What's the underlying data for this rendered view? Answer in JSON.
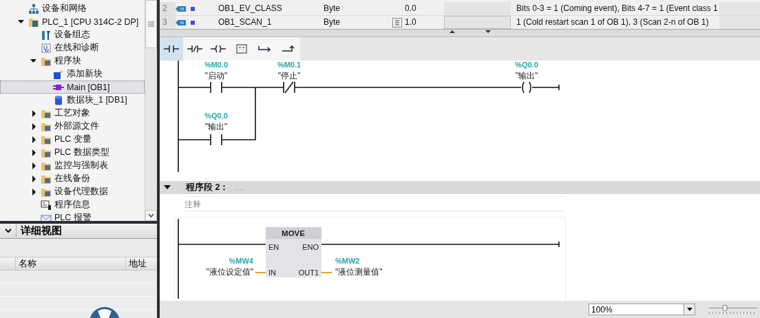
{
  "project_tree": {
    "items": [
      {
        "label": "设备和网络",
        "kind": "network",
        "selected": false
      },
      {
        "label": "PLC_1 [CPU 314C-2 DP]",
        "kind": "plc",
        "selected": false,
        "expanded": true,
        "children": [
          {
            "label": "设备组态",
            "kind": "config",
            "selected": false
          },
          {
            "label": "在线和诊断",
            "kind": "diagnostics",
            "selected": false
          },
          {
            "label": "程序块",
            "kind": "folder",
            "selected": false,
            "expanded": true,
            "children": [
              {
                "label": "添加新块",
                "kind": "add",
                "selected": false
              },
              {
                "label": "Main [OB1]",
                "kind": "ob",
                "selected": true
              },
              {
                "label": "数据块_1 [DB1]",
                "kind": "db",
                "selected": false
              }
            ]
          },
          {
            "label": "工艺对象",
            "kind": "folder",
            "selected": false,
            "expanded": false
          },
          {
            "label": "外部源文件",
            "kind": "folder",
            "selected": false,
            "expanded": false
          },
          {
            "label": "PLC 变量",
            "kind": "folder",
            "selected": false,
            "expanded": false
          },
          {
            "label": "PLC 数据类型",
            "kind": "folder",
            "selected": false,
            "expanded": false
          },
          {
            "label": "监控与强制表",
            "kind": "folder",
            "selected": false,
            "expanded": false
          },
          {
            "label": "在线备份",
            "kind": "folder",
            "selected": false,
            "expanded": false
          },
          {
            "label": "设备代理数据",
            "kind": "folder",
            "selected": false,
            "expanded": false
          },
          {
            "label": "程序信息",
            "kind": "info",
            "selected": false
          },
          {
            "label": "PLC 报警",
            "kind": "alarm",
            "selected": false
          }
        ]
      }
    ]
  },
  "details_view": {
    "title": "详细视图",
    "expanded": true,
    "columns": [
      "名称",
      "地址"
    ]
  },
  "interface_table": {
    "rows": [
      {
        "index": "2",
        "name": "OB1_EV_CLASS",
        "type": "Byte",
        "value": "0.0",
        "comment": "Bits 0-3 = 1 (Coming event), Bits 4-7 = 1 (Event class 1",
        "editing": false
      },
      {
        "index": "3",
        "name": "OB1_SCAN_1",
        "type": "Byte",
        "value": "1.0",
        "comment": "1 (Cold restart scan 1 of OB 1), 3 (Scan 2-n of OB 1)",
        "editing": true
      }
    ]
  },
  "toolbar": [
    {
      "kind": "no-contact",
      "selected": true
    },
    {
      "kind": "nc-contact",
      "selected": false
    },
    {
      "kind": "coil",
      "selected": false
    },
    {
      "kind": "empty-box",
      "selected": false
    },
    {
      "kind": "open-branch",
      "selected": false
    },
    {
      "kind": "close-branch",
      "selected": false
    }
  ],
  "network_1": {
    "elements": [
      {
        "kind": "no",
        "address": "%M0.0",
        "tag": "\"启动\""
      },
      {
        "kind": "nc",
        "address": "%M0.1",
        "tag": "\"停止\""
      },
      {
        "kind": "coil",
        "address": "%Q0.0",
        "tag": "\"输出\""
      }
    ],
    "branch": {
      "kind": "no",
      "address": "%Q0.0",
      "tag": "\"输出\""
    }
  },
  "network_2": {
    "title": "程序段 2：",
    "title_suffix": "......",
    "expanded": true,
    "comment": "注释",
    "box": {
      "name": "MOVE",
      "inputs": [
        "EN",
        "IN"
      ],
      "outputs": [
        "ENO",
        "OUT1"
      ]
    },
    "in_operand": {
      "address": "%MW4",
      "tag": "\"液位设定值\""
    },
    "out_operand": {
      "address": "%MW2",
      "tag": "\"液位测量值\""
    }
  },
  "status_bar": {
    "zoom": "100%",
    "zoom_slider": {
      "level": 0.33
    }
  }
}
